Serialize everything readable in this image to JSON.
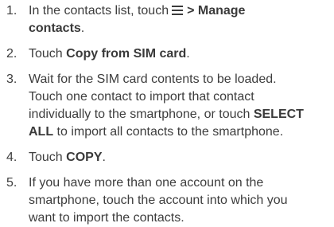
{
  "steps": [
    {
      "number": "1.",
      "pre": "In the contacts list, touch",
      "icon": "menu-icon",
      "bold_after_icon": "> Manage",
      "bold_line2": "contacts",
      "post": "."
    },
    {
      "number": "2.",
      "pre": "Touch ",
      "bold": "Copy from SIM card",
      "post": "."
    },
    {
      "number": "3.",
      "line1": "Wait for the SIM card contents to be loaded.",
      "line2": "Touch one contact to import that contact",
      "line3_pre": "individually to the smartphone, or touch ",
      "line3_bold": "SELECT",
      "line4_bold": "ALL",
      "line4_post": " to import all contacts to the smartphone."
    },
    {
      "number": "4.",
      "pre": "Touch ",
      "bold": "COPY",
      "post": "."
    },
    {
      "number": "5.",
      "line1": "If you have more than one account on the",
      "line2": "smartphone, touch the account into which you",
      "line3": "want to import the contacts."
    }
  ]
}
